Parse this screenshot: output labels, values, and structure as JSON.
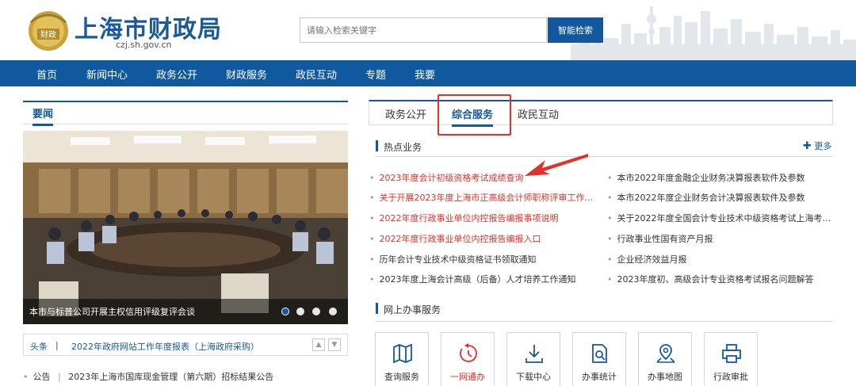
{
  "header": {
    "site_title": "上海市财政局",
    "site_domain": "czj.sh.gov.cn",
    "search_placeholder": "请输入检索关键字",
    "search_button": "智能检索"
  },
  "nav": [
    "首页",
    "新闻中心",
    "政务公开",
    "财政服务",
    "政民互动",
    "专题",
    "我要"
  ],
  "news": {
    "tab": "要闻",
    "photo_caption": "本市与标普公司开展主权信用评级复评会谈",
    "headline_tag": "头条",
    "headline_sep": "|",
    "headline_text": "2022年政府网站工作年度报表（上海政府采购）",
    "notice_bullet": "•",
    "notice_tag": "公告",
    "notice_sep": "|",
    "notice_text": "2023年上海市国库现金管理（第六期）招标结果公告"
  },
  "right_tabs": [
    "政务公开",
    "综合服务",
    "政民互动"
  ],
  "hot": {
    "title": "热点业务",
    "more": "更多",
    "left_items": [
      {
        "text": "2023年度会计初级资格考试成绩查询",
        "color": "red"
      },
      {
        "text": "关于开展2023年度上海市正高级会计师职称评审工作…",
        "color": "red"
      },
      {
        "text": "2022年度行政事业单位内控报告编报事项说明",
        "color": "red"
      },
      {
        "text": "2022年度行政事业单位内控报告编报入口",
        "color": "red"
      },
      {
        "text": "历年会计专业技术中级资格证书领取通知",
        "color": "normal"
      },
      {
        "text": "2023年度上海会计高级（后备）人才培养工作通知",
        "color": "normal"
      }
    ],
    "right_items": [
      {
        "text": "本市2022年度金融企业财务决算报表软件及参数",
        "color": "normal"
      },
      {
        "text": "本市2022年度企业财务会计决算报表软件及参数",
        "color": "normal"
      },
      {
        "text": "关于2022年度全国会计专业技术中级资格考试上海考…",
        "color": "normal"
      },
      {
        "text": "行政事业性国有资产月报",
        "color": "normal"
      },
      {
        "text": "企业经济效益月报",
        "color": "normal"
      },
      {
        "text": "2023年度初、高级会计专业资格考试报名问题解答",
        "color": "normal"
      }
    ]
  },
  "online": {
    "title": "网上办事服务",
    "services": [
      {
        "label": "查询服务",
        "icon": "map-book-icon",
        "color": "normal"
      },
      {
        "label": "一网通办",
        "icon": "clock-refresh-icon",
        "color": "red"
      },
      {
        "label": "下载中心",
        "icon": "download-icon",
        "color": "normal"
      },
      {
        "label": "办事统计",
        "icon": "document-search-icon",
        "color": "normal"
      },
      {
        "label": "办事地图",
        "icon": "map-pin-icon",
        "color": "normal"
      },
      {
        "label": "行政审批",
        "icon": "printer-icon",
        "color": "normal"
      }
    ]
  },
  "colors": {
    "brand_blue": "#13589e",
    "nav_blue": "#10599f",
    "highlight_red": "#e0322a"
  }
}
